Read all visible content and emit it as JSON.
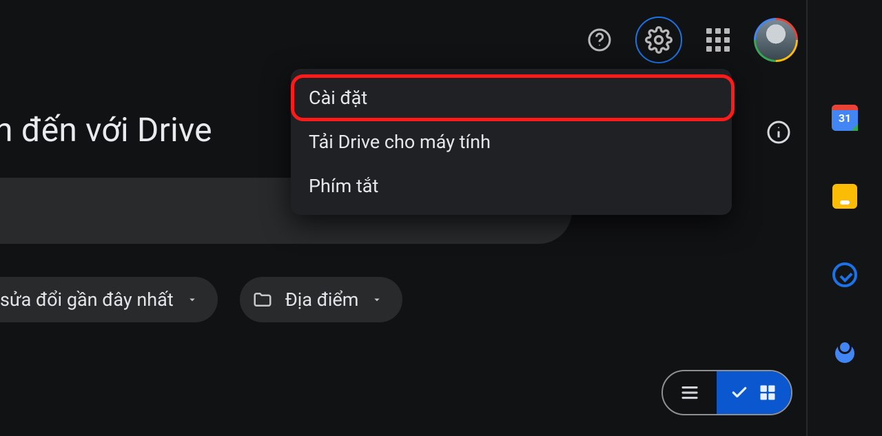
{
  "headline": "n đến với Drive",
  "topbar": {
    "help": "help",
    "settings": "settings",
    "apps": "apps"
  },
  "menu": {
    "items": [
      {
        "label": "Cài đặt",
        "highlighted": true
      },
      {
        "label": "Tải Drive cho máy tính",
        "highlighted": false
      },
      {
        "label": "Phím tắt",
        "highlighted": false
      }
    ]
  },
  "chips": {
    "modified": {
      "label": "sửa đổi gần đây nhất"
    },
    "location": {
      "label": "Địa điểm"
    }
  },
  "sidepanel": {
    "calendar_day": "31"
  },
  "view": {
    "list": "list",
    "grid": "grid"
  }
}
